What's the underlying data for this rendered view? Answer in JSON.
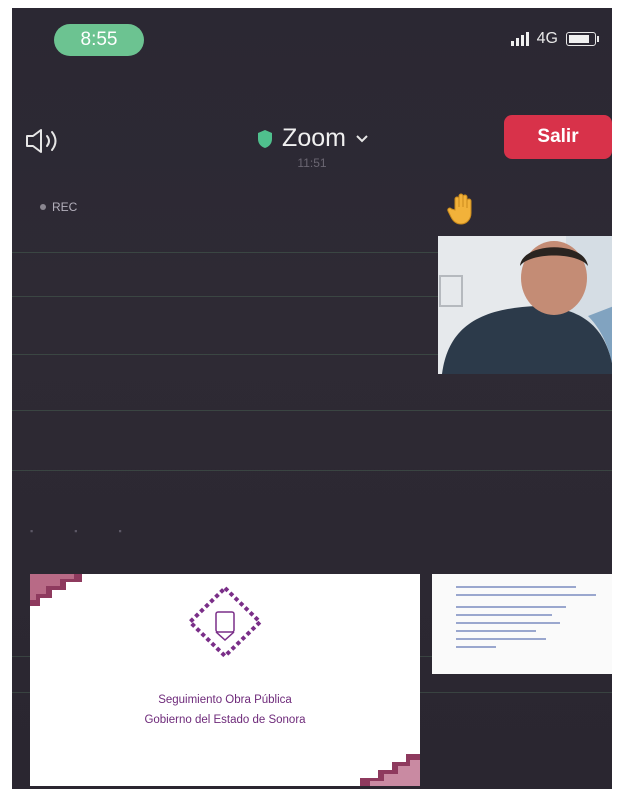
{
  "status_bar": {
    "time": "8:55",
    "network": "4G"
  },
  "header": {
    "app_title": "Zoom",
    "meeting_timer": "11:51",
    "leave_label": "Salir"
  },
  "recording": {
    "label": "REC"
  },
  "shared_content": {
    "slide_line_1": "Seguimiento Obra Pública",
    "slide_line_2": "Gobierno del Estado de Sonora"
  },
  "colors": {
    "leave_button": "#d8324a",
    "time_pill": "#6cc391",
    "shield": "#4fc08d",
    "slide_accent": "#7a2e88"
  },
  "icons": {
    "speaker": "speaker-icon",
    "shield": "shield-icon",
    "chevron": "chevron-down-icon",
    "hand": "raised-hand-icon"
  }
}
